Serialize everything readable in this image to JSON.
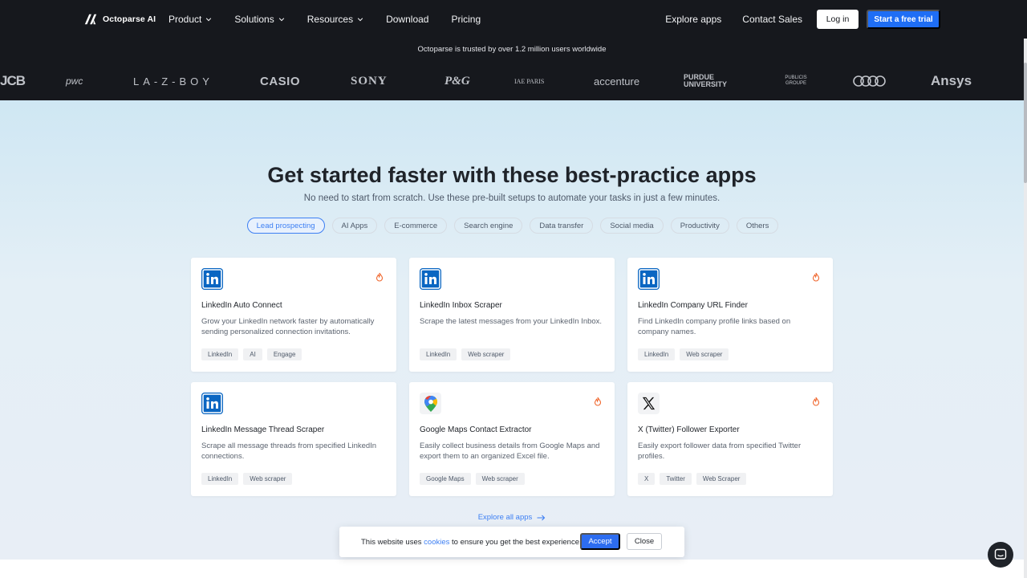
{
  "brand": {
    "name": "Octoparse AI"
  },
  "nav": {
    "menu": [
      {
        "label": "Product",
        "dropdown": true
      },
      {
        "label": "Solutions",
        "dropdown": true
      },
      {
        "label": "Resources",
        "dropdown": true
      },
      {
        "label": "Download",
        "dropdown": false
      },
      {
        "label": "Pricing",
        "dropdown": false
      }
    ],
    "explore_apps": "Explore apps",
    "contact_sales": "Contact Sales",
    "login": "Log in",
    "trial": "Start a free trial"
  },
  "trust": {
    "text": "Octoparse is trusted by over 1.2 million users worldwide",
    "logos": [
      "JCB",
      "pwc",
      "LA-Z-BOY",
      "CASIO",
      "SONY",
      "P&G",
      "IAE PARIS",
      "accenture",
      "PURDUE UNIVERSITY",
      "PUBLICIS GROUPE",
      "audi-rings",
      "Ansys"
    ]
  },
  "hero": {
    "title": "Get started faster with these best-practice apps",
    "subtitle": "No need to start from scratch. Use these pre-built setups to automate your tasks in just a few minutes."
  },
  "filters": [
    "Lead prospecting",
    "AI Apps",
    "E-commerce",
    "Search engine",
    "Data transfer",
    "Social media",
    "Productivity",
    "Others"
  ],
  "active_filter": "Lead prospecting",
  "cards": [
    {
      "title": "LinkedIn Auto Connect",
      "desc": "Grow your LinkedIn network faster by automatically sending personalized connection invitations.",
      "icon": "linkedin-icon",
      "hot": true,
      "tags": [
        "LinkedIn",
        "AI",
        "Engage"
      ]
    },
    {
      "title": "LinkedIn Inbox Scraper",
      "desc": "Scrape the latest messages from your LinkedIn Inbox.",
      "icon": "linkedin-icon",
      "hot": false,
      "tags": [
        "LinkedIn",
        "Web scraper"
      ]
    },
    {
      "title": "LinkedIn Company URL Finder",
      "desc": "Find LinkedIn company profile links based on company names.",
      "icon": "linkedin-icon",
      "hot": true,
      "tags": [
        "LinkedIn",
        "Web scraper"
      ]
    },
    {
      "title": "LinkedIn Message Thread Scraper",
      "desc": "Scrape all message threads from specified LinkedIn connections.",
      "icon": "linkedin-icon",
      "hot": false,
      "tags": [
        "LinkedIn",
        "Web scraper"
      ]
    },
    {
      "title": "Google Maps Contact Extractor",
      "desc": "Easily collect business details from Google Maps and export them to an organized Excel file.",
      "icon": "google-maps-icon",
      "hot": true,
      "tags": [
        "Google Maps",
        "Web scraper"
      ]
    },
    {
      "title": "X (Twitter) Follower Exporter",
      "desc": "Easily export follower data from specified Twitter profiles.",
      "icon": "x-twitter-icon",
      "hot": true,
      "tags": [
        "X",
        "Twitter",
        "Web Scraper"
      ]
    }
  ],
  "explore_all": "Explore all apps",
  "cookie": {
    "text_before": "This website uses ",
    "link": "cookies",
    "text_after": " to ensure you get the best experience.",
    "accept": "Accept",
    "close": "Close"
  },
  "colors": {
    "nav_bg": "#16181d",
    "accent": "#1f6ef5",
    "linkedin": "#0a66c2",
    "hot": "#f0672e"
  }
}
